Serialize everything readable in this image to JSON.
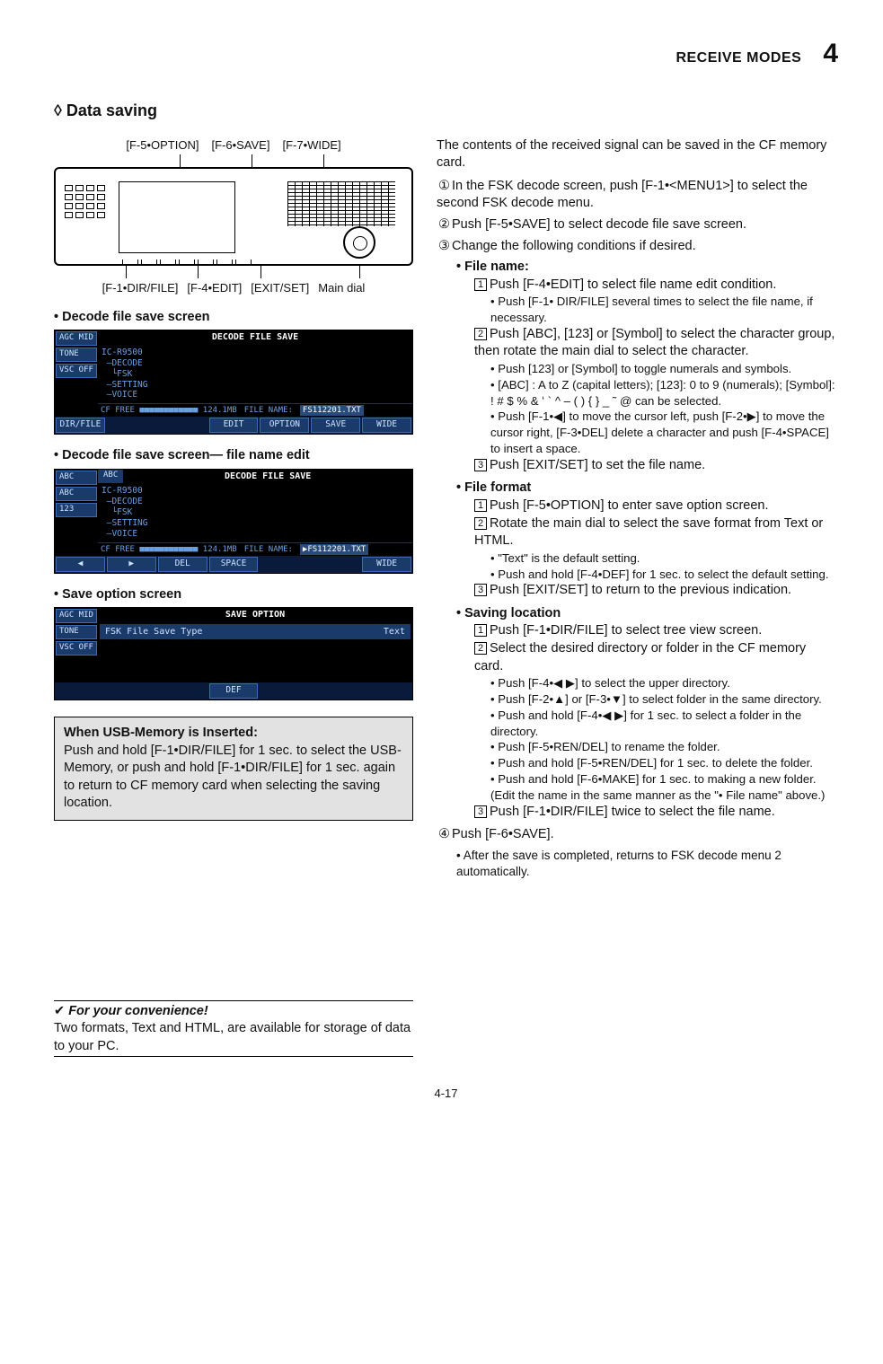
{
  "header": {
    "title": "RECEIVE MODES",
    "chapter": "4"
  },
  "section": {
    "diamond": "◊",
    "title": "Data saving"
  },
  "diagram": {
    "top_labels": [
      "[F-5•OPTION]",
      "[F-6•SAVE]",
      "[F-7•WIDE]"
    ],
    "bottom_labels": [
      "[F-1•DIR/FILE]",
      "[F-4•EDIT]",
      "[EXIT/SET]",
      "Main dial"
    ]
  },
  "screens": {
    "save": {
      "heading": "• Decode file save screen",
      "title": "DECODE FILE SAVE",
      "side": [
        "AGC\nMID",
        "TONE",
        "VSC\nOFF"
      ],
      "tree": "IC-R9500\n —DECODE\n  └FSK\n —SETTING\n —VOICE",
      "status_left": "CF  FREE ■■■■■■■■■■■■ 124.1MB",
      "status_file_label": "FILE NAME:",
      "status_file": "FS112201.TXT",
      "softkeys": [
        "DIR/FILE",
        "",
        "",
        "EDIT",
        "OPTION",
        "SAVE",
        "WIDE"
      ]
    },
    "edit": {
      "heading": "• Decode file save screen— file name edit",
      "title": "DECODE FILE SAVE",
      "side": [
        "ABC",
        "ABC",
        "123"
      ],
      "top_bar": "ABC",
      "tree": "IC-R9500\n —DECODE\n  └FSK\n —SETTING\n —VOICE",
      "status_left": "CF  FREE ■■■■■■■■■■■■ 124.1MB",
      "status_file_label": "FILE NAME:",
      "status_file": "▶FS112201.TXT",
      "softkeys": [
        "◀",
        "▶",
        "DEL",
        "SPACE",
        "",
        "",
        "WIDE"
      ]
    },
    "option": {
      "heading": "• Save option screen",
      "title": "SAVE OPTION",
      "side": [
        "AGC\nMID",
        "TONE",
        "VSC\nOFF"
      ],
      "row_label": "FSK File Save Type",
      "row_value": "Text",
      "softkeys": [
        "",
        "",
        "",
        "DEF",
        "",
        "",
        ""
      ]
    }
  },
  "infobox": {
    "title": "When USB-Memory is Inserted:",
    "body": "Push and hold [F-1•DIR/FILE] for 1 sec. to select the USB-Memory, or push and hold [F-1•DIR/FILE] for 1 sec. again to return to CF memory card when selecting the saving location."
  },
  "tip": {
    "check": "✔",
    "title": "For your convenience!",
    "body": "Two formats, Text and HTML, are available for storage of data to your PC."
  },
  "right": {
    "intro": "The contents of the received signal can be saved in the CF memory card.",
    "steps": {
      "s1": {
        "n": "①",
        "t": "In the FSK decode screen, push [F-1•<MENU1>] to select the second FSK decode menu."
      },
      "s2": {
        "n": "②",
        "t": "Push [F-5•SAVE] to select decode file save screen."
      },
      "s3": {
        "n": "③",
        "t": "Change the following conditions if desired."
      },
      "s4": {
        "n": "④",
        "t": "Push [F-6•SAVE]."
      },
      "s4_sub": "• After the save is completed, returns to FSK decode menu 2 automatically."
    },
    "filename": {
      "h": "• File name:",
      "b1": "Push [F-4•EDIT] to select file name edit condition.",
      "b1s": "• Push [F-1• DIR/FILE] several times to select the file name, if necessary.",
      "b2": "Push [ABC], [123] or [Symbol] to select the character group, then rotate the main dial to select the character.",
      "b2s1": "• Push [123] or [Symbol] to toggle numerals and symbols.",
      "b2s2": "• [ABC] : A to Z (capital letters); [123]: 0 to 9 (numerals); [Symbol]: ! # $ % & ʻ ` ^ – ( ) { } _ ˜ @ can be selected.",
      "b2s3": "• Push [F-1•◀] to move the cursor left, push [F-2•▶] to move the cursor right, [F-3•DEL] delete a character and push [F-4•SPACE] to insert a space.",
      "b3": "Push [EXIT/SET] to set the file name."
    },
    "fileformat": {
      "h": "• File format",
      "b1": "Push [F-5•OPTION] to enter save option screen.",
      "b2": "Rotate the main dial to select the save format from Text or HTML.",
      "b2s1": "• \"Text\" is the default setting.",
      "b2s2": "• Push and hold [F-4•DEF] for 1 sec. to select the default setting.",
      "b3": "Push [EXIT/SET] to return to the previous indication."
    },
    "savingloc": {
      "h": "• Saving location",
      "b1": "Push [F-1•DIR/FILE] to select tree view screen.",
      "b2": "Select the desired directory or folder in the CF memory card.",
      "b2s1": "• Push [F-4•◀ ▶] to select the upper directory.",
      "b2s2": "• Push [F-2•▲] or [F-3•▼] to select folder in the same directory.",
      "b2s3": "• Push and hold [F-4•◀ ▶] for 1 sec. to select a folder in the directory.",
      "b2s4": "• Push [F-5•REN/DEL] to rename the folder.",
      "b2s5": "• Push and hold [F-5•REN/DEL] for 1 sec. to delete the folder.",
      "b2s6": "• Push and hold [F-6•MAKE] for 1 sec. to making a new folder. (Edit the name in the same manner as the \"• File name\" above.)",
      "b3": "Push [F-1•DIR/FILE] twice to select the file name."
    }
  },
  "page": "4-17"
}
